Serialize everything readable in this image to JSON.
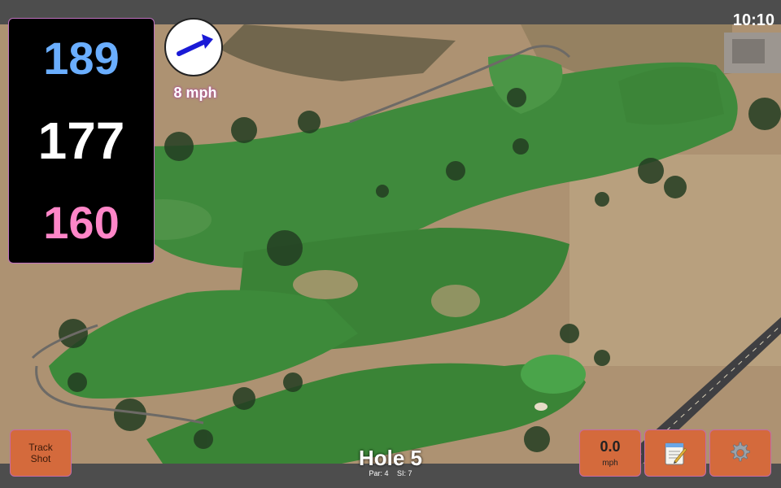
{
  "status": {
    "time": "10:10"
  },
  "distances": {
    "back": "189",
    "middle": "177",
    "front": "160"
  },
  "wind": {
    "speed_text": "8 mph",
    "direction_icon": "arrow-up-right-icon",
    "arrow_color": "#1a1ad6"
  },
  "hole": {
    "title": "Hole 5",
    "par_text": "Par: 4",
    "si_text": "SI: 7"
  },
  "buttons": {
    "track_shot_line1": "Track",
    "track_shot_line2": "Shot",
    "speed_value": "0.0",
    "speed_unit": "mph",
    "notes_icon": "notepad-icon",
    "settings_icon": "gear-icon"
  },
  "colors": {
    "back_distance": "#6aaeff",
    "middle_distance": "#ffffff",
    "front_distance": "#ff86c8",
    "button_bg": "#d46a3c",
    "fairway": "#3f8a3c"
  }
}
